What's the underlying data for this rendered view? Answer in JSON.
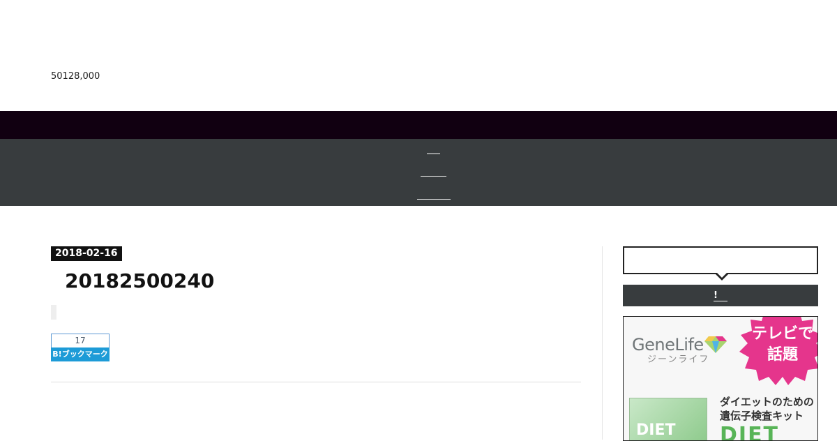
{
  "header": {
    "site_description": "50128,000"
  },
  "colors": {
    "topbar": "#110011",
    "navbar": "#383c3e",
    "date_badge": "#111111",
    "hatena_blue": "#1d9bd7",
    "ad_pink": "#e5358c",
    "ad_green": "#58b457"
  },
  "nav": {
    "items": [
      "",
      "",
      ""
    ]
  },
  "post": {
    "date": "2018-02-16",
    "title": "20182500240"
  },
  "share": {
    "hatena_count": "17",
    "hatena_label": "B!ブックマーク"
  },
  "sidebar": {
    "heading": "!"
  },
  "ad": {
    "brand": "GeneLife",
    "brand_kana": "ジーンライフ",
    "badge": "テレビで話題",
    "copy_line1": "ダイエットのための",
    "copy_line2": "遺伝子検査キット",
    "product": "DIET",
    "box_label": "DIET"
  }
}
